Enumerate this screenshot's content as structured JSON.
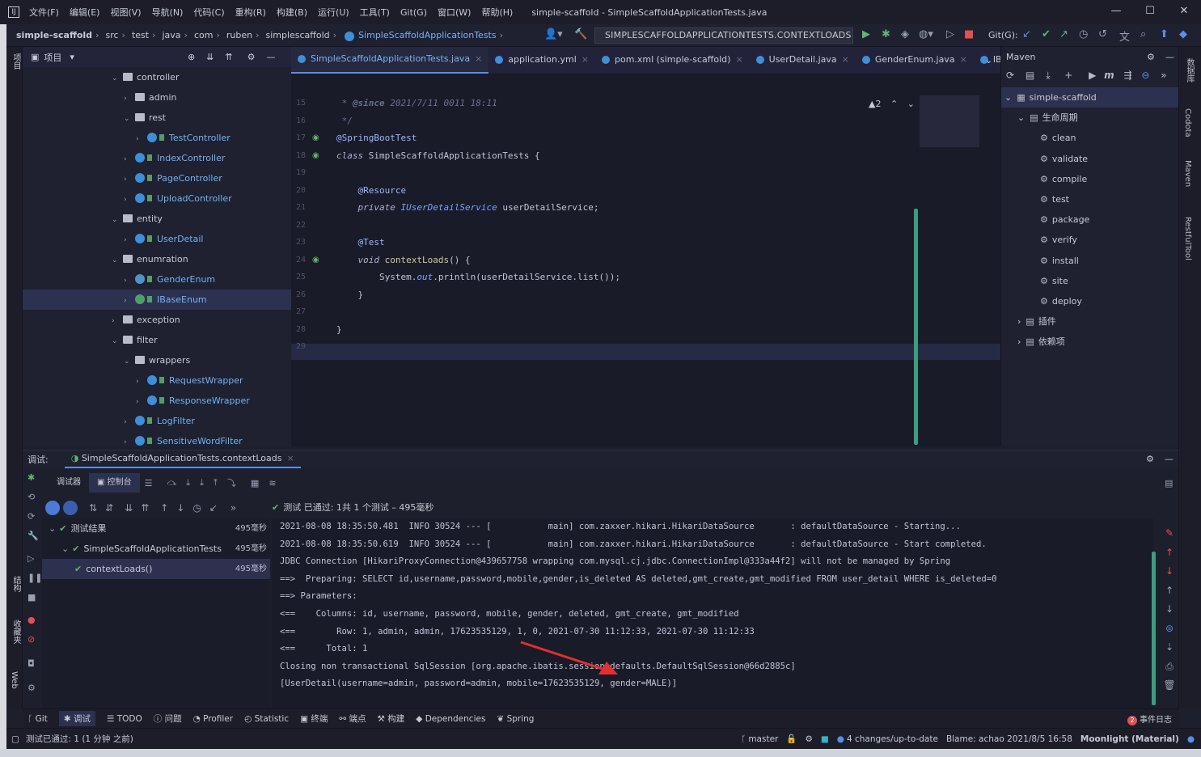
{
  "menu": {
    "items": [
      "文件(F)",
      "编辑(E)",
      "视图(V)",
      "导航(N)",
      "代码(C)",
      "重构(R)",
      "构建(B)",
      "运行(U)",
      "工具(T)",
      "Git(G)",
      "窗口(W)",
      "帮助(H)"
    ],
    "window_title": "simple-scaffold - SimpleScaffoldApplicationTests.java"
  },
  "breadcrumb": [
    "simple-scaffold",
    "src",
    "test",
    "java",
    "com",
    "ruben",
    "simplescaffold",
    "SimpleScaffoldApplicationTests"
  ],
  "run_config": "SIMPLESCAFFOLDAPPLICATIONTESTS.CONTEXTLOADS",
  "git_label": "Git(G):",
  "project": {
    "title": "项目",
    "tree": [
      {
        "label": "controller",
        "depth": 2,
        "kind": "folder",
        "open": true
      },
      {
        "label": "admin",
        "depth": 3,
        "kind": "folder",
        "open": false
      },
      {
        "label": "rest",
        "depth": 3,
        "kind": "folder",
        "open": true
      },
      {
        "label": "TestController",
        "depth": 4,
        "kind": "class"
      },
      {
        "label": "IndexController",
        "depth": 3,
        "kind": "class"
      },
      {
        "label": "PageController",
        "depth": 3,
        "kind": "class"
      },
      {
        "label": "UploadController",
        "depth": 3,
        "kind": "class"
      },
      {
        "label": "entity",
        "depth": 2,
        "kind": "folder",
        "open": true
      },
      {
        "label": "UserDetail",
        "depth": 3,
        "kind": "class"
      },
      {
        "label": "enumration",
        "depth": 2,
        "kind": "folder",
        "open": true
      },
      {
        "label": "GenderEnum",
        "depth": 3,
        "kind": "enum"
      },
      {
        "label": "IBaseEnum",
        "depth": 3,
        "kind": "interface",
        "selected": true
      },
      {
        "label": "exception",
        "depth": 2,
        "kind": "folder",
        "open": false
      },
      {
        "label": "filter",
        "depth": 2,
        "kind": "folder",
        "open": true
      },
      {
        "label": "wrappers",
        "depth": 3,
        "kind": "folder",
        "open": true
      },
      {
        "label": "RequestWrapper",
        "depth": 4,
        "kind": "class"
      },
      {
        "label": "ResponseWrapper",
        "depth": 4,
        "kind": "class"
      },
      {
        "label": "LogFilter",
        "depth": 3,
        "kind": "class"
      },
      {
        "label": "SensitiveWordFilter",
        "depth": 3,
        "kind": "class"
      }
    ]
  },
  "editor_tabs": [
    {
      "label": "SimpleScaffoldApplicationTests.java",
      "active": true
    },
    {
      "label": "application.yml"
    },
    {
      "label": "pom.xml (simple-scaffold)"
    },
    {
      "label": "UserDetail.java"
    },
    {
      "label": "GenderEnum.java"
    },
    {
      "label": "IBase"
    }
  ],
  "warnings_count": "2",
  "code_lines": [
    {
      "n": "15",
      "html": "<span class='c-cm'> * <b>@since</b> 2021/7/11 0011 18:11</span>"
    },
    {
      "n": "16",
      "html": "<span class='c-cm'> */</span>"
    },
    {
      "n": "17",
      "html": "<span class='c-an'>@SpringBootTest</span>"
    },
    {
      "n": "18",
      "html": "<span class='c-kw'>class</span> SimpleScaffoldApplicationTests {"
    },
    {
      "n": "19",
      "html": ""
    },
    {
      "n": "20",
      "html": "    <span class='c-an'>@Resource</span>"
    },
    {
      "n": "21",
      "html": "    <span class='c-kw'>private</span> <span class='c-ty'>IUserDetailService</span> userDetailService;"
    },
    {
      "n": "22",
      "html": ""
    },
    {
      "n": "23",
      "html": "    <span class='c-an'>@Test</span>"
    },
    {
      "n": "24",
      "html": "    <span class='c-kw'>void</span> <span class='c-fn'>contextLoads</span>() {"
    },
    {
      "n": "25",
      "html": "        System.<span class='c-ty'>out</span>.println(userDetailService.list());"
    },
    {
      "n": "26",
      "html": "    }"
    },
    {
      "n": "27",
      "html": ""
    },
    {
      "n": "28",
      "html": "}"
    },
    {
      "n": "29",
      "html": ""
    }
  ],
  "maven": {
    "title": "Maven",
    "root": "simple-scaffold",
    "lifecycle": "生命周期",
    "goals": [
      "clean",
      "validate",
      "compile",
      "test",
      "package",
      "verify",
      "install",
      "site",
      "deploy"
    ],
    "plugins": "插件",
    "deps": "依赖项"
  },
  "right_strip": [
    "数据库",
    "Codota",
    "Maven",
    "RestfulTool"
  ],
  "left_strip": [
    "项目",
    "结构",
    "收藏夹",
    "Web"
  ],
  "debug": {
    "label": "调试:",
    "tab": "SimpleScaffoldApplicationTests.contextLoads",
    "subtabs": [
      "调试器",
      "控制台"
    ],
    "pass_summary": "测试 已通过: 1共 1 个测试 – 495毫秒",
    "results": [
      {
        "label": "测试结果",
        "time": "495毫秒",
        "indent": 0
      },
      {
        "label": "SimpleScaffoldApplicationTests",
        "time": "495毫秒",
        "indent": 1
      },
      {
        "label": "contextLoads()",
        "time": "495毫秒",
        "indent": 2,
        "selected": true
      }
    ],
    "console": [
      "2021-08-08 18:35:50.481  INFO 30524 --- [           main] com.zaxxer.hikari.HikariDataSource       : defaultDataSource - Starting...",
      "2021-08-08 18:35:50.619  INFO 30524 --- [           main] com.zaxxer.hikari.HikariDataSource       : defaultDataSource - Start completed.",
      "JDBC Connection [HikariProxyConnection@439657758 wrapping com.mysql.cj.jdbc.ConnectionImpl@333a44f2] will not be managed by Spring",
      "==>  Preparing: SELECT id,username,password,mobile,gender,is_deleted AS deleted,gmt_create,gmt_modified FROM user_detail WHERE is_deleted=0",
      "==> Parameters: ",
      "<==    Columns: id, username, password, mobile, gender, deleted, gmt_create, gmt_modified",
      "<==        Row: 1, admin, admin, 17623535129, 1, 0, 2021-07-30 11:12:33, 2021-07-30 11:12:33",
      "<==      Total: 1",
      "Closing non transactional SqlSession [org.apache.ibatis.session.defaults.DefaultSqlSession@66d2885c]",
      "[UserDetail(username=admin, password=admin, mobile=17623535129, gender=MALE)]"
    ]
  },
  "tool_windows": [
    "Git",
    "调试",
    "TODO",
    "问题",
    "Profiler",
    "Statistic",
    "终端",
    "端点",
    "构建",
    "Dependencies",
    "Spring"
  ],
  "event_log": "事件日志",
  "event_count": "2",
  "status": {
    "left": "测试已通过: 1 (1 分钟 之前)",
    "branch": "master",
    "changes": "4 changes/up-to-date",
    "blame": "Blame: achao 2021/8/5 16:58",
    "theme": "Moonlight (Material)"
  },
  "colors": {
    "accent": "#5a8ee8",
    "pass": "#5fb66c",
    "arrow": "#e03030"
  }
}
